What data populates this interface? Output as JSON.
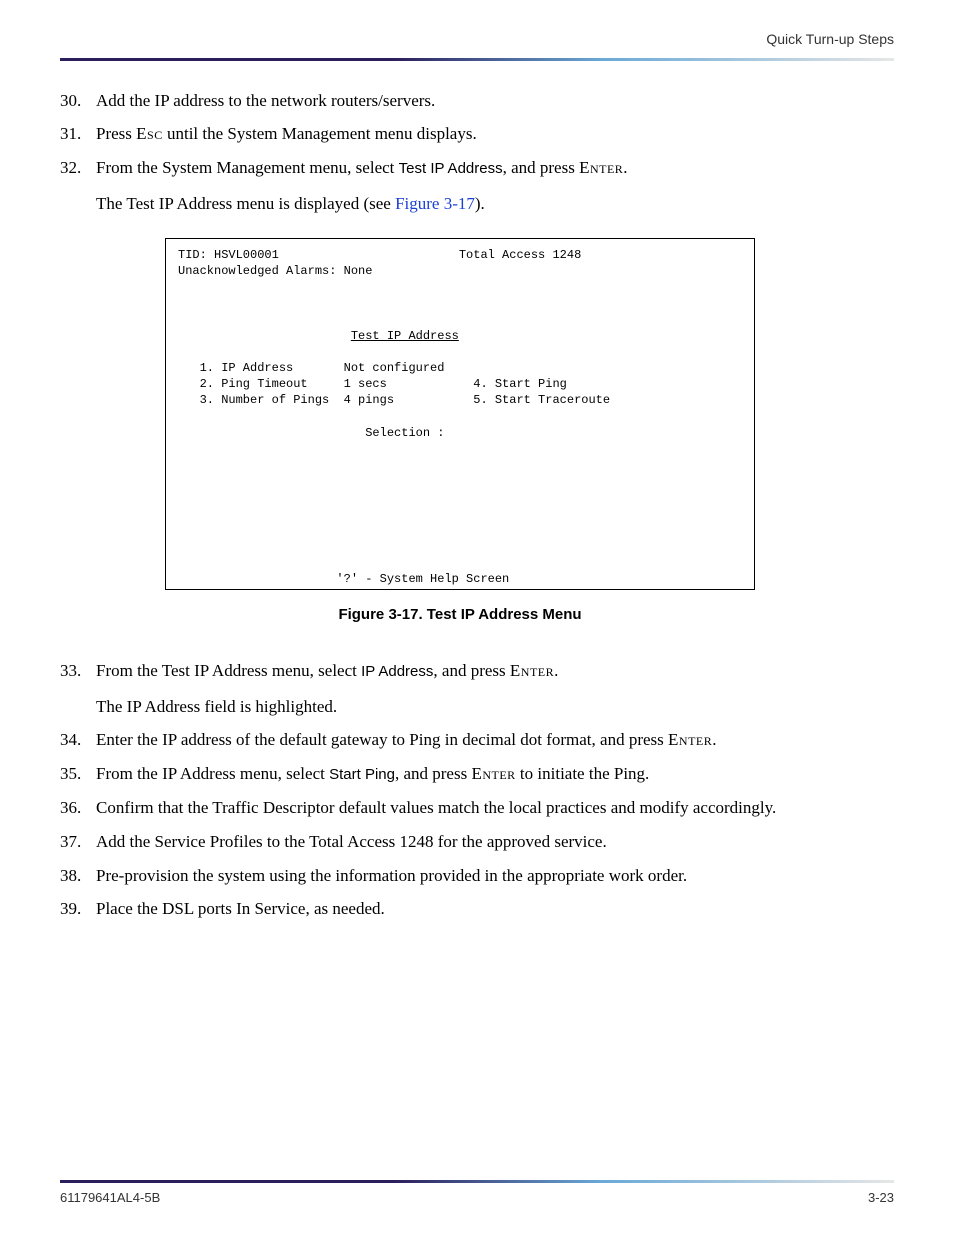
{
  "header": {
    "title": "Quick Turn-up Steps"
  },
  "steps": {
    "s30": {
      "num": "30.",
      "text": "Add the IP address to the network routers/servers."
    },
    "s31": {
      "num": "31.",
      "pre": "Press ",
      "key": "Esc",
      "post": " until the System Management menu displays."
    },
    "s32": {
      "num": "32.",
      "pre": "From the System Management menu, select ",
      "menu": "Test IP Address",
      "mid": ", and press ",
      "key": "Enter",
      "post": ".",
      "sub_pre": "The Test IP Address menu is displayed (see ",
      "sub_link": "Figure 3-17",
      "sub_post": ")."
    },
    "s33": {
      "num": "33.",
      "pre": "From the Test IP Address menu, select ",
      "menu": "IP Address",
      "mid": ", and press ",
      "key": "Enter",
      "post": ".",
      "sub": "The IP Address field is highlighted."
    },
    "s34": {
      "num": "34.",
      "pre": "Enter the IP address of the default gateway to Ping in decimal dot format, and press ",
      "key": "Enter",
      "post": "."
    },
    "s35": {
      "num": "35.",
      "pre": "From the IP Address menu, select ",
      "menu": "Start Ping",
      "mid": ", and press ",
      "key": "Enter",
      "post": " to initiate the Ping."
    },
    "s36": {
      "num": "36.",
      "text": "Confirm that the Traffic Descriptor default values match the local practices and modify accordingly."
    },
    "s37": {
      "num": "37.",
      "text": "Add the Service Profiles to the Total Access 1248 for the approved service."
    },
    "s38": {
      "num": "38.",
      "text": "Pre-provision the system using the information provided in the appropriate work order."
    },
    "s39": {
      "num": "39.",
      "text": "Place the DSL ports In Service, as needed."
    }
  },
  "terminal": {
    "line1": "TID: HSVL00001                         Total Access 1248",
    "line2": "Unacknowledged Alarms: None",
    "title": "Test IP Address",
    "opt1": "   1. IP Address       Not configured",
    "opt2": "   2. Ping Timeout     1 secs            4. Start Ping",
    "opt3": "   3. Number of Pings  4 pings           5. Start Traceroute",
    "selection": "                          Selection :",
    "help": "                      '?' - System Help Screen"
  },
  "figure_caption": "Figure 3-17.  Test IP Address Menu",
  "footer": {
    "left": "61179641AL4-5B",
    "right": "3-23"
  }
}
